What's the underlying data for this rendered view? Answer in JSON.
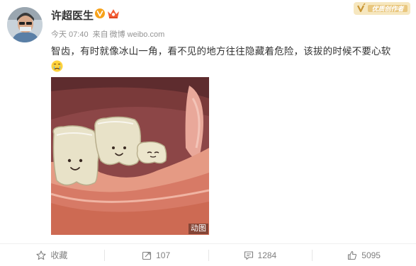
{
  "post": {
    "author": "许超医生",
    "meta": {
      "time": "今天 07:40",
      "source_prefix": "来自",
      "source": "微博 weibo.com"
    },
    "text": "智齿，有时就像冰山一角，看不见的地方往往隐藏着危险，该拔的时候不要心软",
    "emoji_icon": "crying-face-icon",
    "media_badge": "动图",
    "vip_tag_label": "优质创作者"
  },
  "actions": {
    "favorite": {
      "label": "收藏",
      "icon": "star-icon"
    },
    "repost": {
      "count": "107",
      "icon": "repost-icon"
    },
    "comment": {
      "count": "1284",
      "icon": "comment-icon"
    },
    "like": {
      "count": "5095",
      "icon": "thumbs-up-icon"
    }
  },
  "colors": {
    "brand_orange": "#f7a21a",
    "vip_gold": "#e6b85c",
    "muted_text": "#939393"
  }
}
